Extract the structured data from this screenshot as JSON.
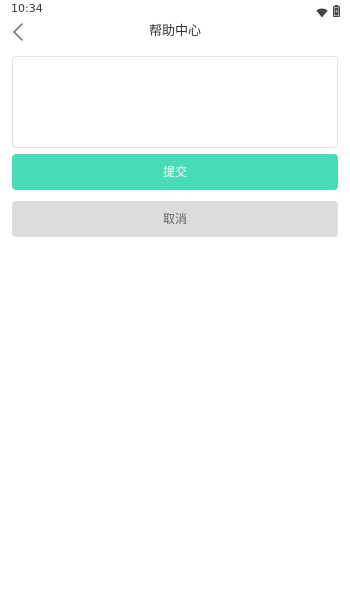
{
  "status_bar": {
    "time": "10:34",
    "wifi_icon": "wifi-icon",
    "battery_icon": "battery-icon"
  },
  "nav": {
    "back_icon": "chevron-left-icon",
    "title": "帮助中心"
  },
  "form": {
    "textarea_value": "",
    "textarea_placeholder": "",
    "submit_label": "提交",
    "cancel_label": "取消"
  },
  "colors": {
    "accent": "#47dcb3",
    "cancel_bg": "#dcdcdc",
    "cancel_text": "#666666",
    "border": "#e1e1e1"
  }
}
